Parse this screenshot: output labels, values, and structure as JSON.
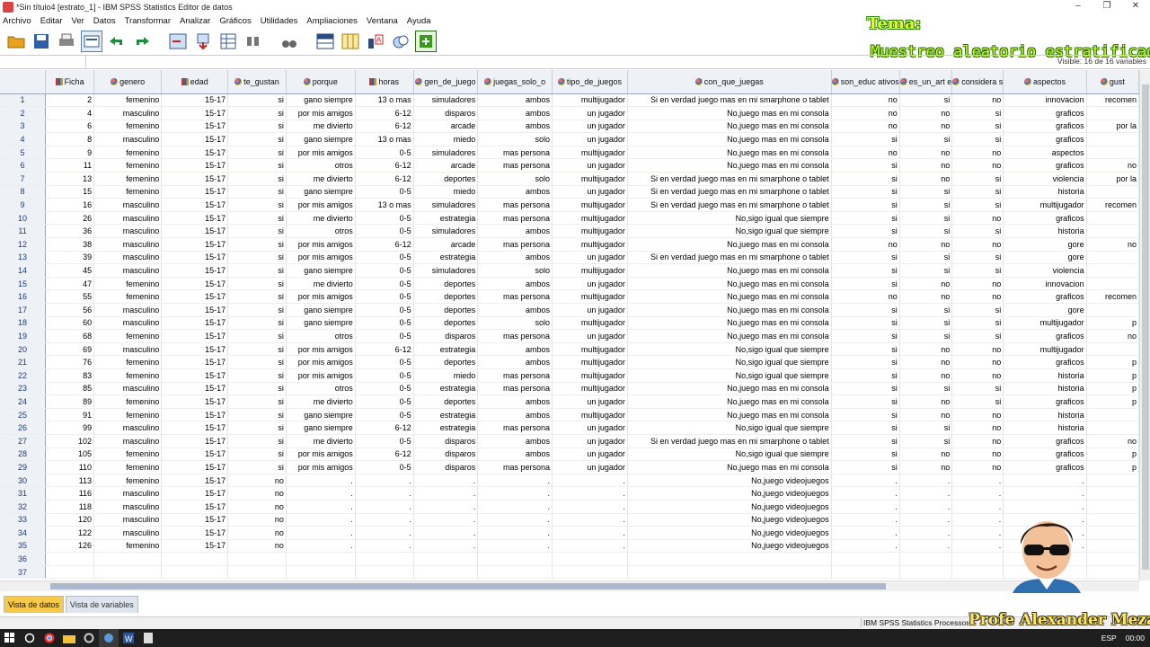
{
  "window": {
    "title": "*Sin título4 [estrato_1] - IBM SPSS Statistics Editor de datos"
  },
  "menu": [
    "Archivo",
    "Editar",
    "Ver",
    "Datos",
    "Transformar",
    "Analizar",
    "Gráficos",
    "Utilidades",
    "Ampliaciones",
    "Ventana",
    "Ayuda"
  ],
  "overlay": {
    "tema": "Tema:",
    "title": "Muestreo aleatorio estratificado",
    "presenter": "Profe Alexander Meza"
  },
  "visible_info": "Visible: 16 de 16 variables",
  "columns": [
    {
      "name": "Ficha",
      "type": "sca"
    },
    {
      "name": "genero",
      "type": "nom"
    },
    {
      "name": "edad",
      "type": "sca"
    },
    {
      "name": "te_gustan",
      "type": "nom"
    },
    {
      "name": "porque",
      "type": "nom"
    },
    {
      "name": "horas",
      "type": "sca"
    },
    {
      "name": "gen_de_juego",
      "type": "nom"
    },
    {
      "name": "juegas_solo_o",
      "type": "nom"
    },
    {
      "name": "tipo_de_juegos",
      "type": "nom"
    },
    {
      "name": "con_que_juegas",
      "type": "nom"
    },
    {
      "name": "son_educ ativos",
      "type": "nom"
    },
    {
      "name": "es_un_art e",
      "type": "nom"
    },
    {
      "name": "considera s",
      "type": "nom"
    },
    {
      "name": "aspectos",
      "type": "nom"
    },
    {
      "name": "gust",
      "type": "nom"
    }
  ],
  "rows": [
    [
      "2",
      "femenino",
      "15-17",
      "si",
      "gano siempre",
      "13 o mas",
      "simuladores",
      "ambos",
      "multijugador",
      "Si en verdad juego mas en mi smarphone o tablet",
      "no",
      "si",
      "no",
      "innovacion",
      "recomen"
    ],
    [
      "4",
      "masculino",
      "15-17",
      "si",
      "por mis amigos",
      "6-12",
      "disparos",
      "ambos",
      "un jugador",
      "No,juego mas en mi consola",
      "no",
      "no",
      "si",
      "graficos",
      ""
    ],
    [
      "6",
      "femenino",
      "15-17",
      "si",
      "me divierto",
      "6-12",
      "arcade",
      "ambos",
      "un jugador",
      "No,juego mas en mi consola",
      "no",
      "no",
      "si",
      "graficos",
      "por la"
    ],
    [
      "8",
      "masculino",
      "15-17",
      "si",
      "gano siempre",
      "13 o mas",
      "miedo",
      "solo",
      "un jugador",
      "No,juego mas en mi consola",
      "si",
      "si",
      "si",
      "graficos",
      ""
    ],
    [
      "9",
      "femenino",
      "15-17",
      "si",
      "por mis amigos",
      "0-5",
      "simuladores",
      "mas persona",
      "multijugador",
      "No,juego mas en mi consola",
      "no",
      "no",
      "no",
      "aspectos",
      ""
    ],
    [
      "11",
      "femenino",
      "15-17",
      "si",
      "otros",
      "6-12",
      "arcade",
      "mas persona",
      "un jugador",
      "No,juego mas en mi consola",
      "si",
      "no",
      "no",
      "graficos",
      "no"
    ],
    [
      "13",
      "femenino",
      "15-17",
      "si",
      "me divierto",
      "6-12",
      "deportes",
      "solo",
      "multijugador",
      "Si en verdad juego mas en mi smarphone o tablet",
      "si",
      "no",
      "si",
      "violencia",
      "por la"
    ],
    [
      "15",
      "femenino",
      "15-17",
      "si",
      "gano siempre",
      "0-5",
      "miedo",
      "ambos",
      "un jugador",
      "Si en verdad juego mas en mi smarphone o tablet",
      "si",
      "si",
      "si",
      "historia",
      ""
    ],
    [
      "16",
      "masculino",
      "15-17",
      "si",
      "por mis amigos",
      "13 o mas",
      "simuladores",
      "mas persona",
      "multijugador",
      "Si en verdad juego mas en mi smarphone o tablet",
      "si",
      "si",
      "si",
      "multijugador",
      "recomen"
    ],
    [
      "26",
      "masculino",
      "15-17",
      "si",
      "me divierto",
      "0-5",
      "estrategia",
      "mas persona",
      "multijugador",
      "No,sigo igual que siempre",
      "si",
      "si",
      "no",
      "graficos",
      ""
    ],
    [
      "36",
      "masculino",
      "15-17",
      "si",
      "otros",
      "0-5",
      "simuladores",
      "ambos",
      "multijugador",
      "No,sigo igual que siempre",
      "si",
      "si",
      "si",
      "historia",
      ""
    ],
    [
      "38",
      "masculino",
      "15-17",
      "si",
      "por mis amigos",
      "6-12",
      "arcade",
      "mas persona",
      "multijugador",
      "No,juego mas en mi consola",
      "no",
      "no",
      "no",
      "gore",
      "no"
    ],
    [
      "39",
      "masculino",
      "15-17",
      "si",
      "por mis amigos",
      "0-5",
      "estrategia",
      "ambos",
      "un jugador",
      "Si en verdad juego mas en mi smarphone o tablet",
      "si",
      "si",
      "si",
      "gore",
      ""
    ],
    [
      "45",
      "masculino",
      "15-17",
      "si",
      "gano siempre",
      "0-5",
      "simuladores",
      "solo",
      "multijugador",
      "No,juego mas en mi consola",
      "si",
      "si",
      "si",
      "violencia",
      ""
    ],
    [
      "47",
      "femenino",
      "15-17",
      "si",
      "me divierto",
      "0-5",
      "deportes",
      "ambos",
      "un jugador",
      "No,juego mas en mi consola",
      "si",
      "no",
      "no",
      "innovacion",
      ""
    ],
    [
      "55",
      "femenino",
      "15-17",
      "si",
      "por mis amigos",
      "0-5",
      "deportes",
      "mas persona",
      "multijugador",
      "No,juego mas en mi consola",
      "no",
      "no",
      "no",
      "graficos",
      "recomen"
    ],
    [
      "56",
      "masculino",
      "15-17",
      "si",
      "gano siempre",
      "0-5",
      "deportes",
      "ambos",
      "un jugador",
      "No,juego mas en mi consola",
      "si",
      "si",
      "si",
      "gore",
      ""
    ],
    [
      "60",
      "masculino",
      "15-17",
      "si",
      "gano siempre",
      "0-5",
      "deportes",
      "solo",
      "multijugador",
      "No,juego mas en mi consola",
      "si",
      "si",
      "si",
      "multijugador",
      "p"
    ],
    [
      "68",
      "femenino",
      "15-17",
      "si",
      "otros",
      "0-5",
      "disparos",
      "mas persona",
      "un jugador",
      "No,juego mas en mi consola",
      "si",
      "si",
      "si",
      "graficos",
      "no"
    ],
    [
      "69",
      "masculino",
      "15-17",
      "si",
      "por mis amigos",
      "6-12",
      "estrategia",
      "ambos",
      "multijugador",
      "No,sigo igual que siempre",
      "si",
      "no",
      "no",
      "multijugador",
      ""
    ],
    [
      "76",
      "femenino",
      "15-17",
      "si",
      "por mis amigos",
      "0-5",
      "deportes",
      "ambos",
      "multijugador",
      "No,sigo igual que siempre",
      "si",
      "no",
      "no",
      "graficos",
      "p"
    ],
    [
      "83",
      "femenino",
      "15-17",
      "si",
      "por mis amigos",
      "0-5",
      "miedo",
      "mas persona",
      "multijugador",
      "No,sigo igual que siempre",
      "si",
      "no",
      "no",
      "historia",
      "p"
    ],
    [
      "85",
      "masculino",
      "15-17",
      "si",
      "otros",
      "0-5",
      "estrategia",
      "mas persona",
      "multijugador",
      "No,juego mas en mi consola",
      "si",
      "si",
      "si",
      "historia",
      "p"
    ],
    [
      "89",
      "femenino",
      "15-17",
      "si",
      "me divierto",
      "0-5",
      "deportes",
      "ambos",
      "un jugador",
      "No,juego mas en mi consola",
      "si",
      "no",
      "si",
      "graficos",
      "p"
    ],
    [
      "91",
      "femenino",
      "15-17",
      "si",
      "gano siempre",
      "0-5",
      "estrategia",
      "ambos",
      "multijugador",
      "No,juego mas en mi consola",
      "si",
      "no",
      "no",
      "historia",
      ""
    ],
    [
      "99",
      "masculino",
      "15-17",
      "si",
      "gano siempre",
      "6-12",
      "estrategia",
      "mas persona",
      "un jugador",
      "No,sigo igual que siempre",
      "si",
      "si",
      "no",
      "historia",
      ""
    ],
    [
      "102",
      "masculino",
      "15-17",
      "si",
      "me divierto",
      "0-5",
      "disparos",
      "ambos",
      "un jugador",
      "Si en verdad juego mas en mi smarphone o tablet",
      "si",
      "si",
      "no",
      "graficos",
      "no"
    ],
    [
      "105",
      "femenino",
      "15-17",
      "si",
      "por mis amigos",
      "6-12",
      "disparos",
      "ambos",
      "un jugador",
      "No,sigo igual que siempre",
      "si",
      "no",
      "no",
      "graficos",
      "p"
    ],
    [
      "110",
      "femenino",
      "15-17",
      "si",
      "por mis amigos",
      "0-5",
      "disparos",
      "mas persona",
      "un jugador",
      "No,juego mas en mi consola",
      "si",
      "no",
      "no",
      "graficos",
      "p"
    ],
    [
      "113",
      "femenino",
      "15-17",
      "no",
      ".",
      ".",
      ".",
      ".",
      ".",
      "No,juego videojuegos",
      ".",
      ".",
      ".",
      ".",
      ""
    ],
    [
      "116",
      "masculino",
      "15-17",
      "no",
      ".",
      ".",
      ".",
      ".",
      ".",
      "No,juego videojuegos",
      ".",
      ".",
      ".",
      ".",
      ""
    ],
    [
      "118",
      "masculino",
      "15-17",
      "no",
      ".",
      ".",
      ".",
      ".",
      ".",
      "No,juego videojuegos",
      ".",
      ".",
      ".",
      ".",
      ""
    ],
    [
      "120",
      "masculino",
      "15-17",
      "no",
      ".",
      ".",
      ".",
      ".",
      ".",
      "No,juego videojuegos",
      ".",
      ".",
      ".",
      ".",
      ""
    ],
    [
      "122",
      "masculino",
      "15-17",
      "no",
      ".",
      ".",
      ".",
      ".",
      ".",
      "No,juego videojuegos",
      ".",
      ".",
      ".",
      ".",
      ""
    ],
    [
      "126",
      "femenino",
      "15-17",
      "no",
      ".",
      ".",
      ".",
      ".",
      ".",
      "No,juego videojuegos",
      ".",
      ".",
      ".",
      ".",
      ""
    ],
    [
      "",
      "",
      "",
      "",
      "",
      "",
      "",
      "",
      "",
      "",
      "",
      "",
      "",
      "",
      ""
    ],
    [
      "",
      "",
      "",
      "",
      "",
      "",
      "",
      "",
      "",
      "",
      "",
      "",
      "",
      "",
      ""
    ]
  ],
  "tabs": [
    "Vista de datos",
    "Vista de variables"
  ],
  "status": {
    "processor": "IBM SPSS Statistics Processor e"
  },
  "taskbar": {
    "lang": "ESP",
    "time": "00:00"
  }
}
